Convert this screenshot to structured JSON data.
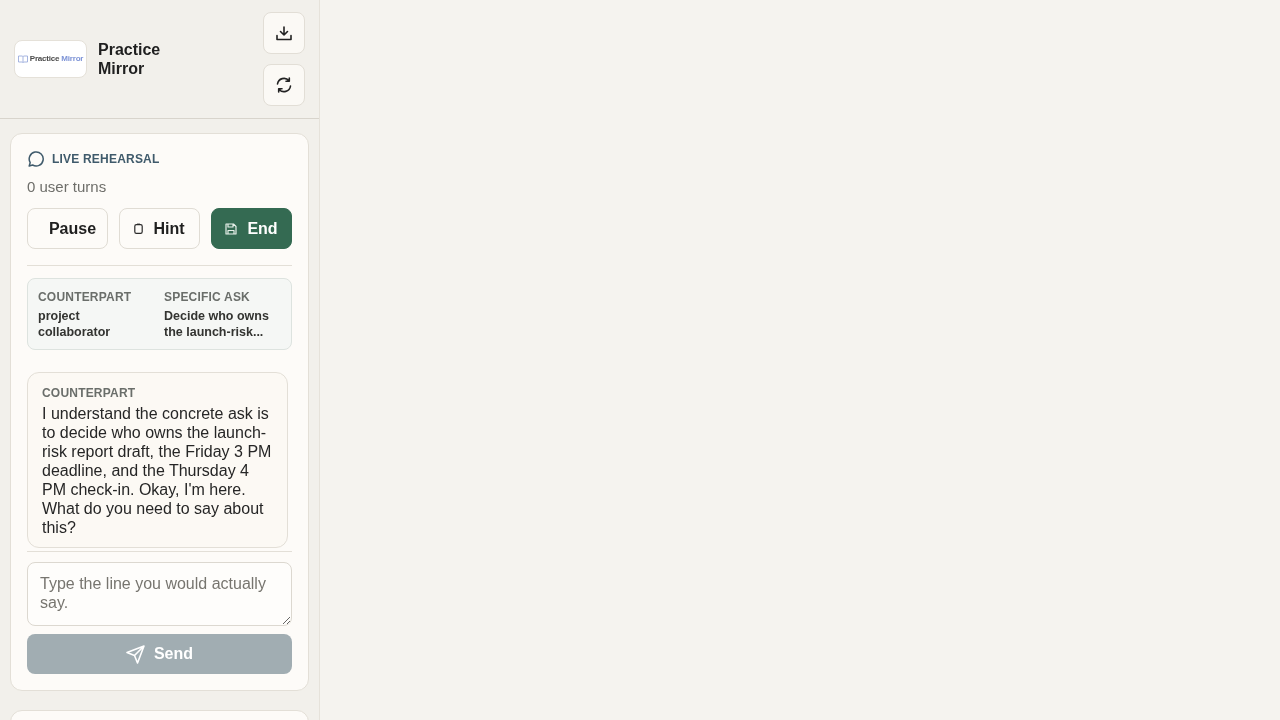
{
  "sidebar": {
    "brand": {
      "logo": {
        "word_1": "Practice",
        "word_2": "Mirror"
      },
      "title": "Practice Mirror"
    },
    "rehearsal": {
      "title": "LIVE REHEARSAL",
      "turn_count": "0 user turns",
      "actions": [
        {
          "label": "Pause",
          "kind": "plain"
        },
        {
          "label": "Hint",
          "kind": "hint"
        },
        {
          "label": "End",
          "kind": "end"
        }
      ],
      "context": [
        {
          "label": "COUNTERPART",
          "value": "project collaborator"
        },
        {
          "label": "SPECIFIC ASK",
          "value": "Decide who owns the launch-risk..."
        }
      ],
      "messages": [
        {
          "speaker": "COUNTERPART",
          "text": "I understand the concrete ask is to decide who owns the launch-risk report draft, the Friday 3 PM deadline, and the Thursday 4 PM check-in. Okay, I'm here. What do you need to say about this?"
        }
      ],
      "composer": {
        "placeholder": "Type the line you would actually say."
      },
      "send_button": {
        "label": "Send",
        "disabled": true
      }
    }
  }
}
